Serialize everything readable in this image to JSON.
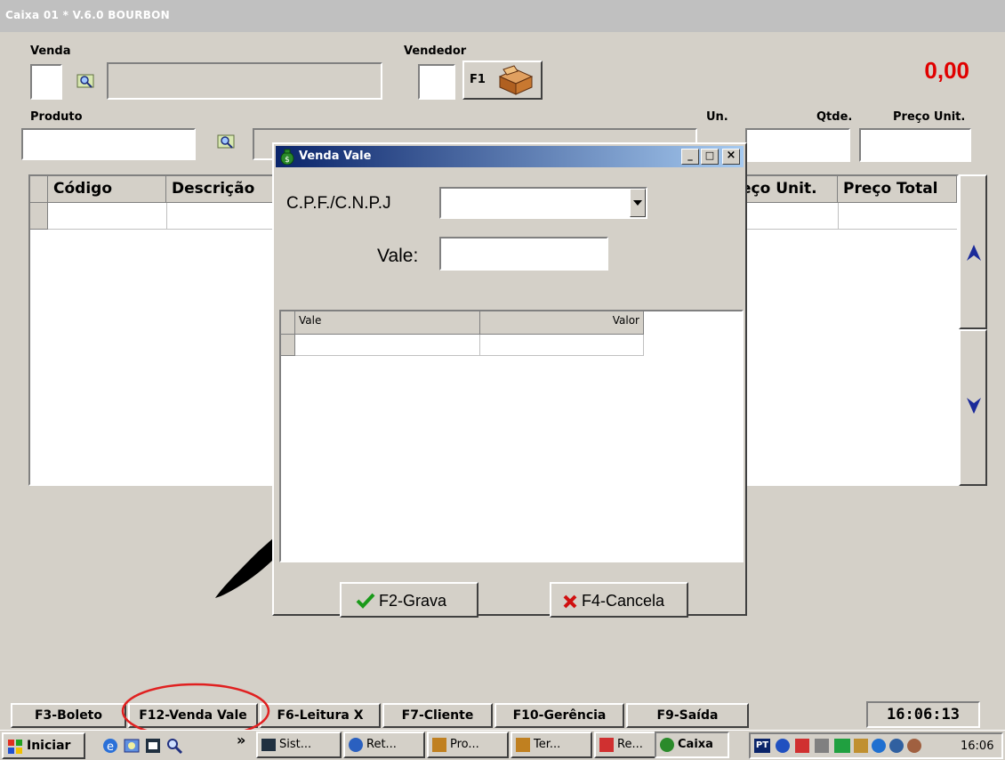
{
  "window": {
    "title": "Caixa 01 * V.6.0   BOURBON"
  },
  "venda": {
    "label": "Venda",
    "code": "",
    "desc": ""
  },
  "vendedor": {
    "label": "Vendedor",
    "code": "",
    "key_label": "F1"
  },
  "total": {
    "value": "0,00",
    "color": "#e00000"
  },
  "produto": {
    "label": "Produto",
    "code": "",
    "desc": ""
  },
  "un": {
    "label": "Un."
  },
  "qtde": {
    "label": "Qtde.",
    "value": ""
  },
  "preco_unit": {
    "label": "Preço Unit.",
    "value": ""
  },
  "grid": {
    "columns": [
      "Código",
      "Descrição",
      "eço Unit.",
      "Preço Total"
    ]
  },
  "dialog": {
    "title": "Venda Vale",
    "cpf_label": "C.P.F./C.N.P.J",
    "cpf_value": "",
    "vale_label": "Vale:",
    "vale_value": "",
    "grid_columns": [
      "Vale",
      "Valor"
    ],
    "grava_label": "F2-Grava",
    "cancela_label": "F4-Cancela",
    "grava_icon": "check-icon",
    "cancela_icon": "x-icon",
    "controls": {
      "minimize": "_",
      "maximize": "□",
      "close": "×"
    }
  },
  "function_keys": [
    "F3-Boleto",
    "F12-Venda Vale",
    "F6-Leitura X",
    "F7-Cliente",
    "F10-Gerência",
    "F9-Saída"
  ],
  "clock": "16:06:13",
  "taskbar": {
    "start_label": "Iniciar",
    "chevron": "»",
    "tasks": [
      "Sist...",
      "Ret...",
      "Pro...",
      "Ter...",
      "Re...",
      "Caixa"
    ],
    "lang": "PT",
    "time": "16:06"
  }
}
